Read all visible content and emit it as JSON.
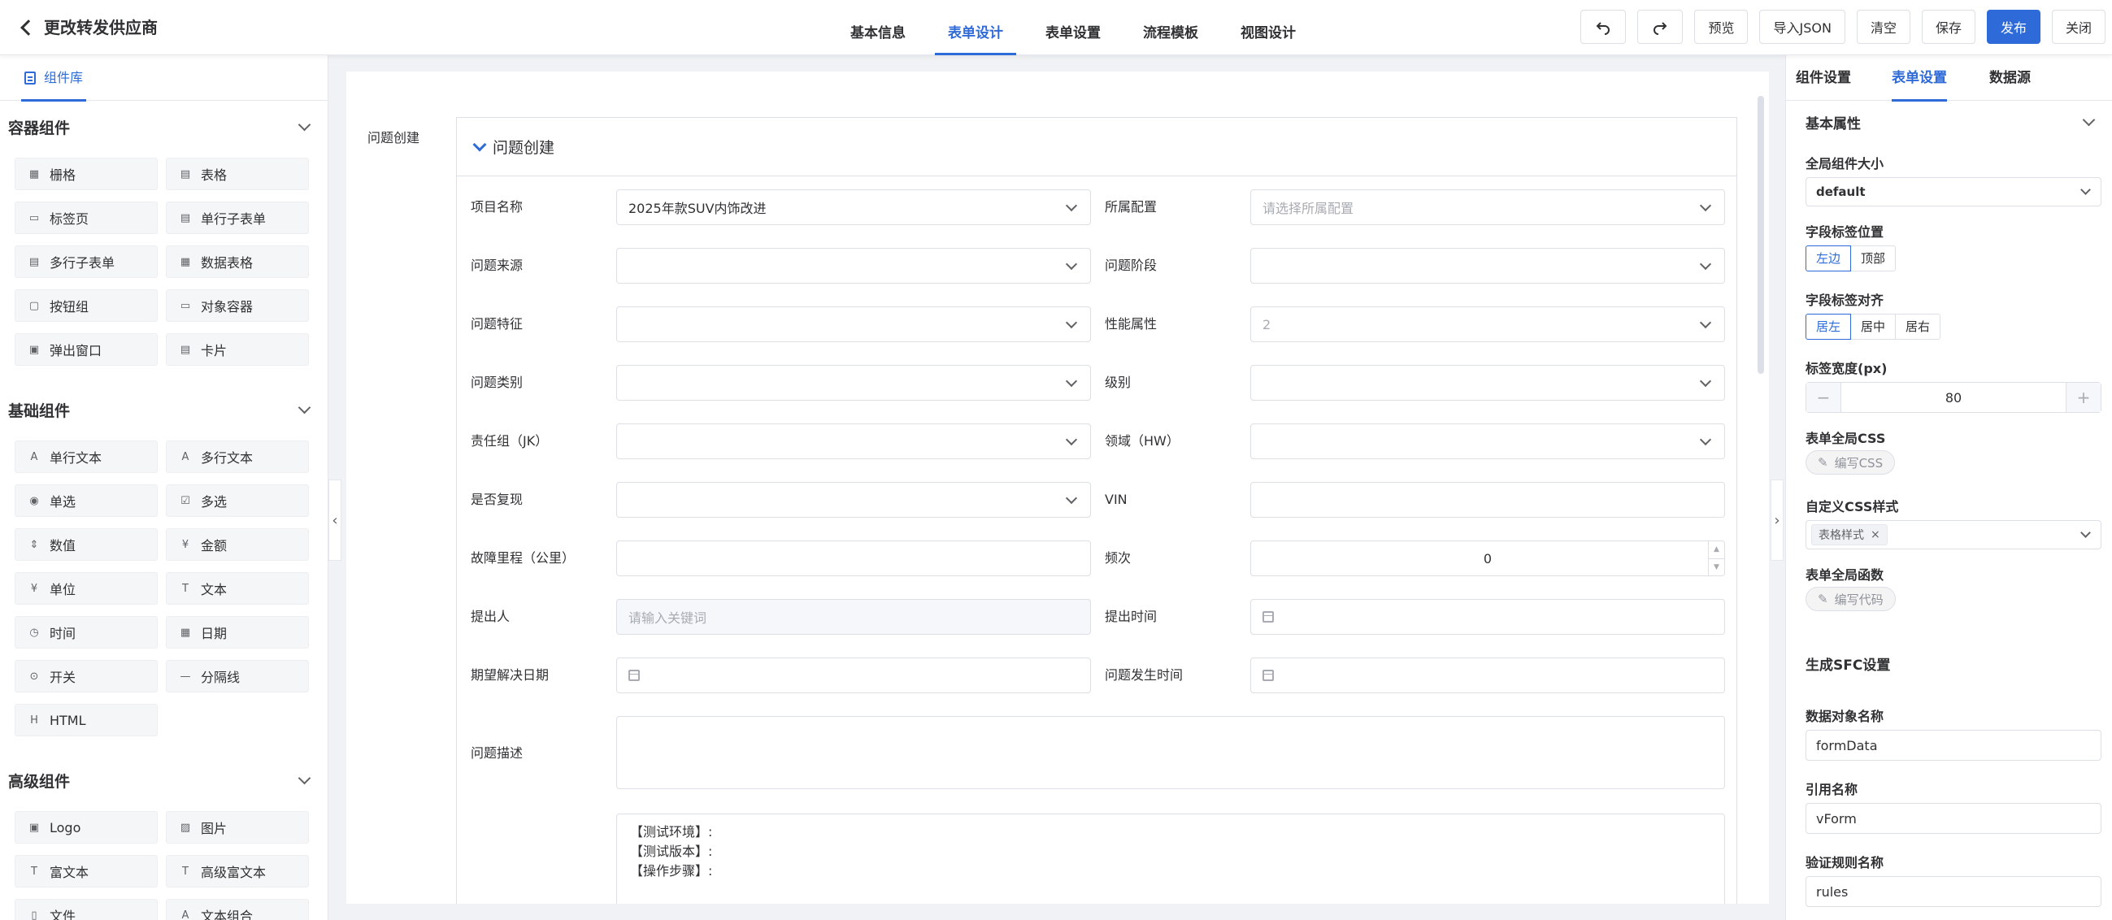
{
  "header": {
    "title": "更改转发供应商",
    "tabs": [
      "基本信息",
      "表单设计",
      "表单设置",
      "流程模板",
      "视图设计"
    ],
    "toolbar": {
      "preview": "预览",
      "import_json": "导入JSON",
      "clear": "清空",
      "save": "保存",
      "publish": "发布",
      "close": "关闭"
    }
  },
  "left": {
    "tab": "组件库",
    "groups": [
      {
        "title": "容器组件",
        "items": [
          {
            "label": "栅格",
            "icon": "grid-icon"
          },
          {
            "label": "表格",
            "icon": "table-icon"
          },
          {
            "label": "标签页",
            "icon": "tabs-icon"
          },
          {
            "label": "单行子表单",
            "icon": "subform-icon"
          },
          {
            "label": "多行子表单",
            "icon": "grid-subform-icon"
          },
          {
            "label": "数据表格",
            "icon": "data-table-icon"
          },
          {
            "label": "按钮组",
            "icon": "button-group-icon"
          },
          {
            "label": "对象容器",
            "icon": "object-container-icon"
          },
          {
            "label": "弹出窗口",
            "icon": "dialog-icon"
          },
          {
            "label": "卡片",
            "icon": "card-icon"
          }
        ]
      },
      {
        "title": "基础组件",
        "items": [
          {
            "label": "单行文本",
            "icon": "input-icon"
          },
          {
            "label": "多行文本",
            "icon": "textarea-icon"
          },
          {
            "label": "单选",
            "icon": "radio-icon"
          },
          {
            "label": "多选",
            "icon": "checkbox-icon"
          },
          {
            "label": "数值",
            "icon": "number-icon"
          },
          {
            "label": "金额",
            "icon": "money-icon"
          },
          {
            "label": "单位",
            "icon": "unit-icon"
          },
          {
            "label": "文本",
            "icon": "text-icon"
          },
          {
            "label": "时间",
            "icon": "time-icon"
          },
          {
            "label": "日期",
            "icon": "date-icon"
          },
          {
            "label": "开关",
            "icon": "switch-icon"
          },
          {
            "label": "分隔线",
            "icon": "divider-icon"
          },
          {
            "label": "HTML",
            "icon": "html-icon"
          }
        ]
      },
      {
        "title": "高级组件",
        "items": [
          {
            "label": "Logo",
            "icon": "logo-icon"
          },
          {
            "label": "图片",
            "icon": "picture-icon"
          },
          {
            "label": "富文本",
            "icon": "rich-text-icon"
          },
          {
            "label": "高级富文本",
            "icon": "advanced-rich-text-icon"
          },
          {
            "label": "文件",
            "icon": "file-icon"
          },
          {
            "label": "文本组合",
            "icon": "text-group-icon"
          }
        ]
      }
    ]
  },
  "canvas": {
    "form_label": "问题创建",
    "section_title": "问题创建",
    "fields": {
      "project_name": {
        "label": "项目名称",
        "value": "2025年款SUV内饰改进"
      },
      "config": {
        "label": "所属配置",
        "placeholder": "请选择所属配置"
      },
      "source": {
        "label": "问题来源",
        "value": ""
      },
      "stage": {
        "label": "问题阶段",
        "value": ""
      },
      "feature": {
        "label": "问题特征",
        "value": ""
      },
      "performance": {
        "label": "性能属性",
        "value": "2"
      },
      "category": {
        "label": "问题类别",
        "value": ""
      },
      "level": {
        "label": "级别",
        "value": ""
      },
      "team": {
        "label": "责任组（JK）",
        "value": ""
      },
      "domain": {
        "label": "领域（HW）",
        "value": ""
      },
      "reproduce": {
        "label": "是否复现",
        "value": ""
      },
      "vin": {
        "label": "VIN",
        "value": ""
      },
      "mileage": {
        "label": "故障里程（公里）",
        "value": ""
      },
      "frequency": {
        "label": "频次",
        "value": "0"
      },
      "submitter": {
        "label": "提出人",
        "placeholder": "请输入关键词"
      },
      "submit_time": {
        "label": "提出时间",
        "value": ""
      },
      "expected_date": {
        "label": "期望解决日期",
        "value": ""
      },
      "occur_time": {
        "label": "问题发生时间",
        "value": ""
      },
      "description": {
        "label": "问题描述",
        "value": ""
      }
    },
    "template_lines": [
      "【测试环境】:",
      "【测试版本】:",
      "【操作步骤】:"
    ]
  },
  "right": {
    "tabs": [
      "组件设置",
      "表单设置",
      "数据源"
    ],
    "basic_title": "基本属性",
    "size_label": "全局组件大小",
    "size_value": "default",
    "label_pos_label": "字段标签位置",
    "label_pos_options": [
      "左边",
      "顶部"
    ],
    "label_align_label": "字段标签对齐",
    "label_align_options": [
      "居左",
      "居中",
      "居右"
    ],
    "label_width_label": "标签宽度(px)",
    "label_width_value": "80",
    "global_css_label": "表单全局CSS",
    "global_css_btn": "编写CSS",
    "custom_css_label": "自定义CSS样式",
    "custom_css_tag": "表格样式",
    "global_func_label": "表单全局函数",
    "global_func_btn": "编写代码",
    "sfc_title": "生成SFC设置",
    "data_obj_label": "数据对象名称",
    "data_obj_value": "formData",
    "ref_label": "引用名称",
    "ref_value": "vForm",
    "rules_label": "验证规则名称",
    "rules_value": "rules"
  },
  "colors": {
    "primary": "#2f6bd8",
    "border": "#dcdfe6",
    "bg": "#f0f2f5"
  }
}
